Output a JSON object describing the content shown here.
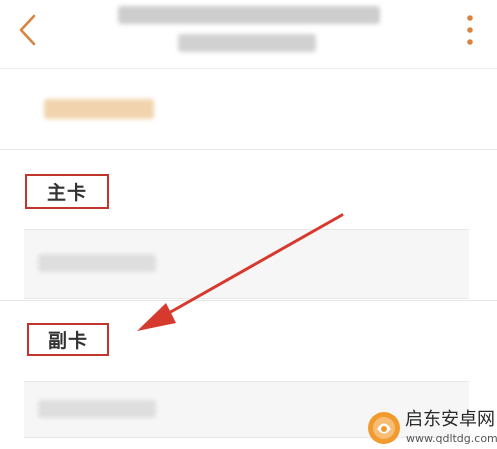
{
  "header": {
    "back_icon": "chevron-left-icon",
    "more_icon": "more-vertical-icon",
    "accent_color": "#d98540"
  },
  "sections": {
    "primary_label": "主卡",
    "secondary_label": "副卡"
  },
  "annotation": {
    "color": "#d63a2f"
  },
  "watermark": {
    "brand": "启东安卓网",
    "url": "www.qdltdg.com"
  }
}
